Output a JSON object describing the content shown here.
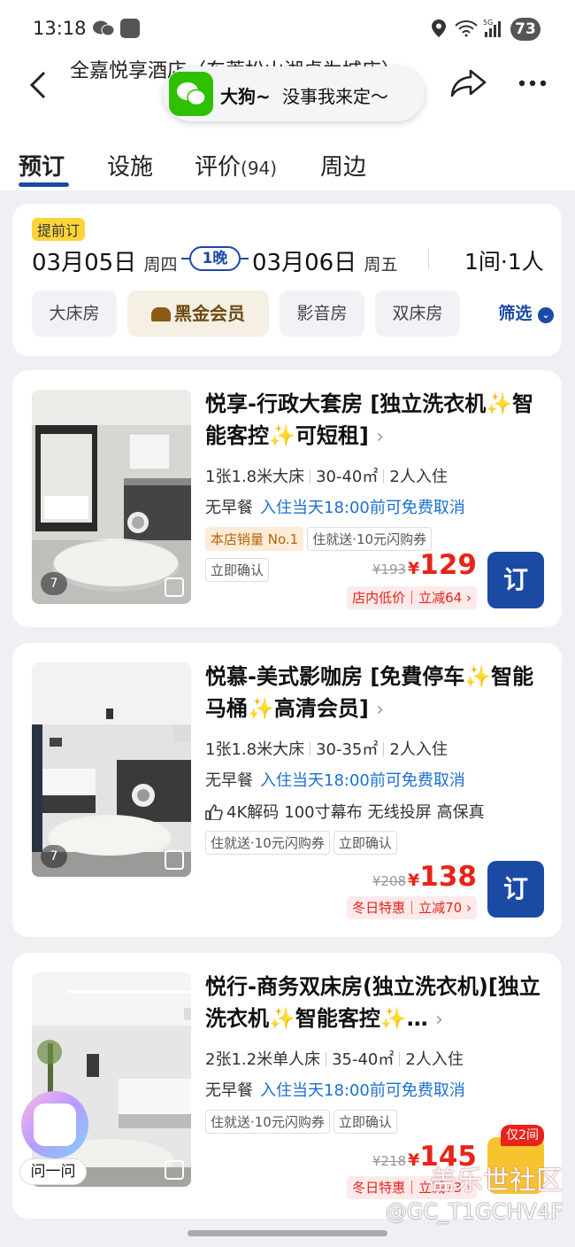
{
  "status": {
    "time": "13:18",
    "battery": "73",
    "net": "5G"
  },
  "header": {
    "hotel_title": "全嘉悦享酒店（东莞松山湖桌为城店）"
  },
  "toast": {
    "name": "大狗~",
    "message": "没事我来定～"
  },
  "tabs": [
    {
      "label": "预订",
      "count": ""
    },
    {
      "label": "设施",
      "count": ""
    },
    {
      "label": "评价",
      "count": "(94)"
    },
    {
      "label": "周边",
      "count": ""
    }
  ],
  "booking": {
    "early_tag": "提前订",
    "checkin_date": "03月05日",
    "checkin_day": "周四",
    "nights": "1晚",
    "checkout_date": "03月06日",
    "checkout_day": "周五",
    "rooms_guests": "1间·1人"
  },
  "filters": [
    "大床房",
    "黑金会员",
    "影音房",
    "双床房"
  ],
  "filter_button": "筛选",
  "rooms": [
    {
      "photo_count": "7",
      "title": "悦享-行政大套房 [独立洗衣机✨智能客控✨可短租]",
      "specs": [
        "1张1.8米大床",
        "30-40㎡",
        "2人入住"
      ],
      "meal": "无早餐",
      "cancel": "入住当天18:00前可免费取消",
      "tags": [
        "本店销量 No.1",
        "住就送·10元闪购券"
      ],
      "tags2": [
        "立即确认"
      ],
      "old_price": "¥193",
      "currency": "¥",
      "price": "129",
      "promo": "店内低价｜立减64 ›",
      "book": "订"
    },
    {
      "photo_count": "7",
      "title": "悦慕-美式影咖房 [免費停车✨智能马桶✨高清会员]",
      "specs": [
        "1张1.8米大床",
        "30-35㎡",
        "2人入住"
      ],
      "meal": "无早餐",
      "cancel": "入住当天18:00前可免费取消",
      "features": [
        "4K解码",
        "100寸幕布",
        "无线投屏",
        "高保真"
      ],
      "tags": [
        "住就送·10元闪购券",
        "立即确认"
      ],
      "old_price": "¥208",
      "currency": "¥",
      "price": "138",
      "promo": "冬日特惠｜立减70 ›",
      "book": "订"
    },
    {
      "title": "悦行-商务双床房(独立洗衣机)[独立洗衣机✨智能客控✨…",
      "specs": [
        "2张1.2米单人床",
        "35-40㎡",
        "2人入住"
      ],
      "meal": "无早餐",
      "cancel": "入住当天18:00前可免费取消",
      "tags": [
        "住就送·10元闪购券",
        "立即确认"
      ],
      "old_price": "¥218",
      "currency": "¥",
      "price": "145",
      "promo": "冬日特惠｜立减73 ›",
      "only_left": "仅2间"
    }
  ],
  "assistant": {
    "label": "问一问"
  },
  "watermark": {
    "line1": "盖乐世社区",
    "line2": "@GC_T1GCHV4F"
  }
}
